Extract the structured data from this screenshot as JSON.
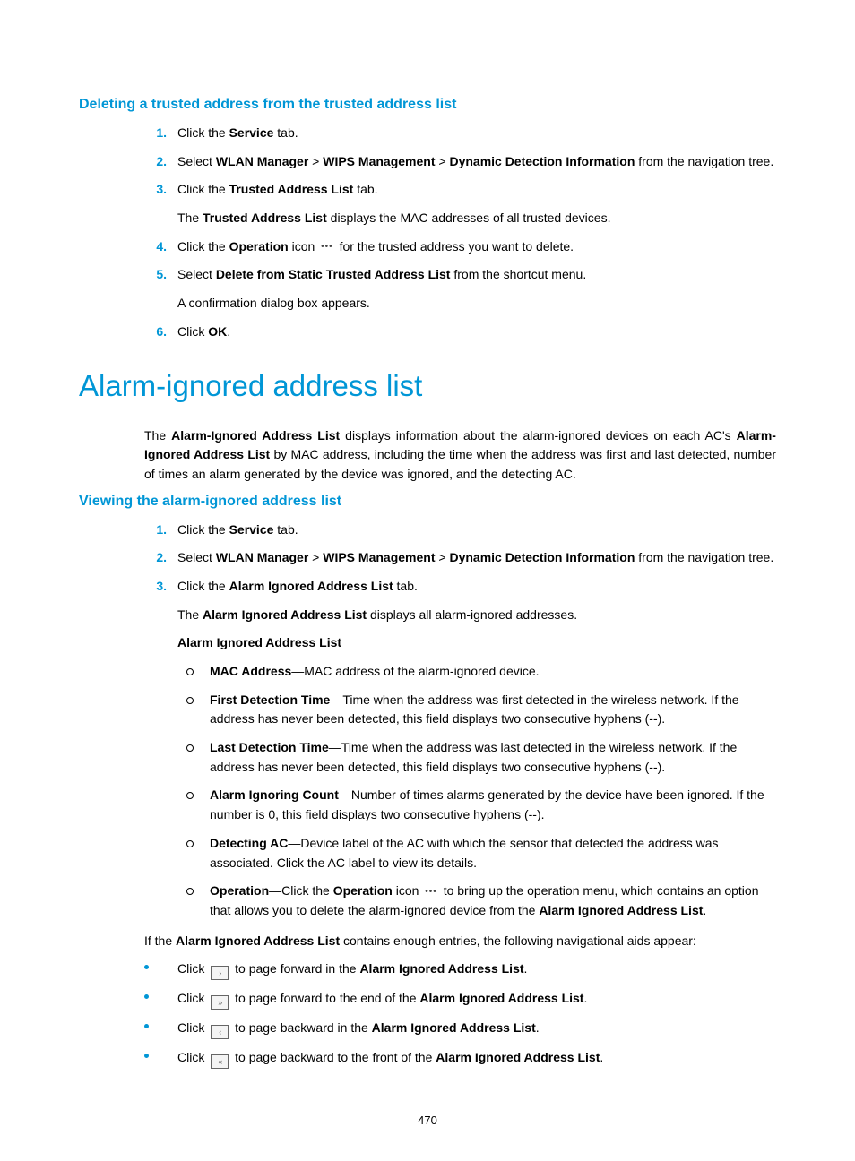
{
  "section1": {
    "title": "Deleting a trusted address from the trusted address list",
    "steps": [
      {
        "num": "1.",
        "pre": "Click the ",
        "b1": "Service",
        "post": " tab."
      },
      {
        "num": "2.",
        "pre": "Select ",
        "b1": "WLAN Manager",
        "sep1": " > ",
        "b2": "WIPS Management",
        "sep2": " > ",
        "b3": "Dynamic Detection Information",
        "post": " from the navigation tree."
      },
      {
        "num": "3.",
        "pre": "Click the ",
        "b1": "Trusted Address List",
        "post": " tab.",
        "after_pre": "The ",
        "after_b": "Trusted Address List",
        "after_post": " displays the MAC addresses of all trusted devices."
      },
      {
        "num": "4.",
        "pre": "Click the ",
        "b1": "Operation",
        "mid": " icon ",
        "icon": "dots",
        "post": " for the trusted address you want to delete."
      },
      {
        "num": "5.",
        "pre": "Select ",
        "b1": "Delete from Static Trusted Address List",
        "post": " from the shortcut menu.",
        "after_plain": "A confirmation dialog box appears."
      },
      {
        "num": "6.",
        "pre": "Click ",
        "b1": "OK",
        "post": "."
      }
    ]
  },
  "section2": {
    "title": "Alarm-ignored address list",
    "intro": {
      "pre": "The ",
      "b1": "Alarm-Ignored Address List",
      "mid": " displays information about the alarm-ignored devices on each AC's ",
      "b2": "Alarm-Ignored Address List",
      "post": " by MAC address, including the time when the address was first and last detected, number of times an alarm generated by the device was ignored, and the detecting AC."
    }
  },
  "section3": {
    "title": "Viewing the alarm-ignored address list",
    "steps": [
      {
        "num": "1.",
        "pre": "Click the ",
        "b1": "Service",
        "post": " tab."
      },
      {
        "num": "2.",
        "pre": "Select ",
        "b1": "WLAN Manager",
        "sep1": " > ",
        "b2": "WIPS Management",
        "sep2": " > ",
        "b3": "Dynamic Detection Information",
        "post": " from the navigation tree."
      },
      {
        "num": "3.",
        "pre": "Click the ",
        "b1": "Alarm Ignored Address List",
        "post": " tab.",
        "after_pre": "The ",
        "after_b": "Alarm Ignored Address List",
        "after_post": " displays all alarm-ignored addresses.",
        "after_b2": "Alarm Ignored Address List",
        "fields": [
          {
            "b": "MAC Address",
            "t": "—MAC address of the alarm-ignored device."
          },
          {
            "b": "First Detection Time",
            "t": "—Time when the address was first detected in the wireless network. If the address has never been detected, this field displays two consecutive hyphens (--)."
          },
          {
            "b": "Last Detection Time",
            "t": "—Time when the address was last detected in the wireless network. If the address has never been detected, this field displays two consecutive hyphens (--)."
          },
          {
            "b": "Alarm Ignoring Count",
            "t": "—Number of times alarms generated by the device have been ignored. If the number is 0, this field displays two consecutive hyphens (--)."
          },
          {
            "b": "Detecting AC",
            "t": "—Device label of the AC with which the sensor that detected the address was associated. Click the AC label to view its details."
          },
          {
            "b": "Operation",
            "t_pre": "—Click the ",
            "t_b": "Operation",
            "t_mid": " icon ",
            "icon": "dots",
            "t_post1": " to bring up the operation menu, which contains an option that allows you to delete the alarm-ignored device from the ",
            "t_b2": "Alarm Ignored Address List",
            "t_post2": "."
          }
        ]
      }
    ],
    "nav_intro": {
      "pre": "If the ",
      "b": "Alarm Ignored Address List",
      "post": " contains enough entries, the following navigational aids appear:"
    },
    "nav": [
      {
        "pre": "Click ",
        "icon": "›",
        "mid": " to page forward in the ",
        "b": "Alarm Ignored Address List",
        "post": "."
      },
      {
        "pre": "Click ",
        "icon": "»",
        "mid": " to page forward to the end of the ",
        "b": "Alarm Ignored Address List",
        "post": "."
      },
      {
        "pre": "Click ",
        "icon": "‹",
        "mid": " to page backward in the ",
        "b": "Alarm Ignored Address List",
        "post": "."
      },
      {
        "pre": "Click ",
        "icon": "«",
        "mid": " to page backward to the front of the ",
        "b": "Alarm Ignored Address List",
        "post": "."
      }
    ]
  },
  "pagenum": "470"
}
